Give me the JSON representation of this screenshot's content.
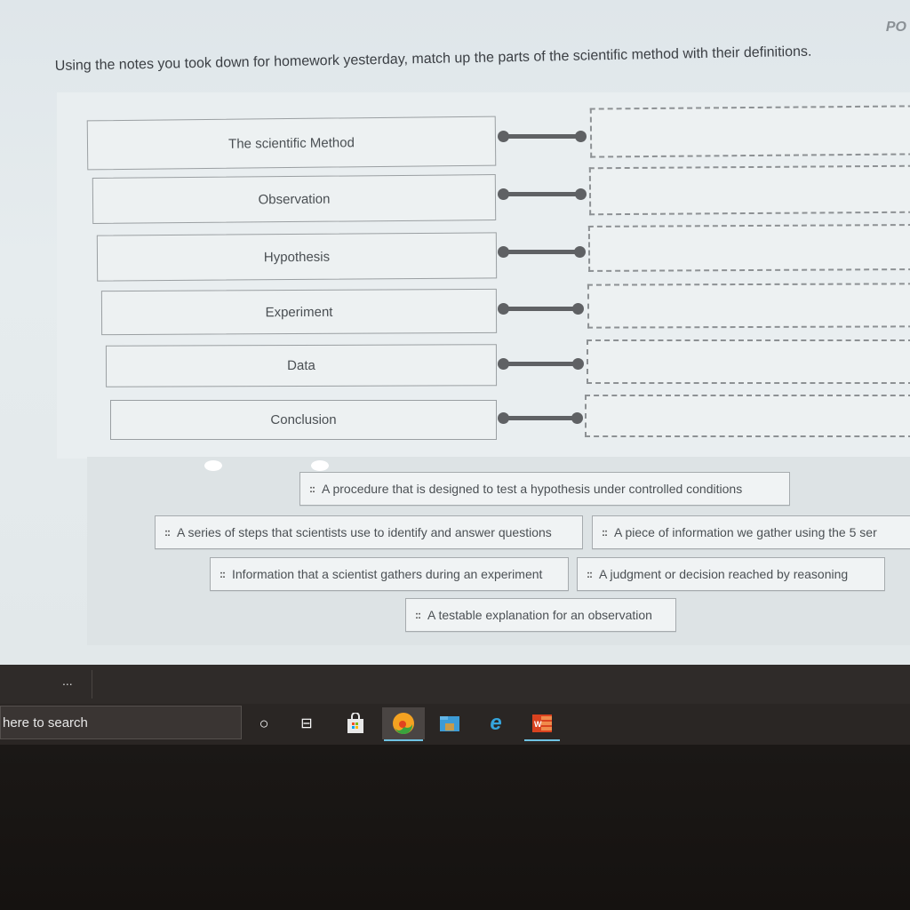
{
  "header": {
    "points_label": "PO",
    "instructions": "Using the notes you took down for homework yesterday, match up the parts of the scientific method with their definitions."
  },
  "terms": [
    {
      "label": "The scientific Method"
    },
    {
      "label": "Observation"
    },
    {
      "label": "Hypothesis"
    },
    {
      "label": "Experiment"
    },
    {
      "label": "Data"
    },
    {
      "label": "Conclusion"
    }
  ],
  "definitions": [
    {
      "label": "A procedure that is designed to test a hypothesis under controlled conditions"
    },
    {
      "label": "A series of steps that scientists use to identify and answer questions"
    },
    {
      "label": "A piece of information we gather using the 5 ser"
    },
    {
      "label": "Information that a scientist gathers during an experiment"
    },
    {
      "label": "A judgment or decision reached by reasoning"
    },
    {
      "label": "A testable explanation for an observation"
    }
  ],
  "drag_grip_icon": "::",
  "taskbar": {
    "more_label": "...",
    "search_placeholder": "here to search",
    "icons": [
      {
        "name": "cortana-icon",
        "glyph": "○"
      },
      {
        "name": "task-view-icon",
        "glyph": "⊟"
      },
      {
        "name": "store-icon",
        "glyph": "🛍"
      },
      {
        "name": "edge-icon",
        "glyph": "◉"
      },
      {
        "name": "file-explorer-icon",
        "glyph": "▬"
      },
      {
        "name": "internet-explorer-icon",
        "glyph": "e"
      },
      {
        "name": "office-icon",
        "glyph": "W"
      }
    ]
  },
  "colors": {
    "accent_underline": "#6fc3e3",
    "connector": "#5f6164"
  }
}
